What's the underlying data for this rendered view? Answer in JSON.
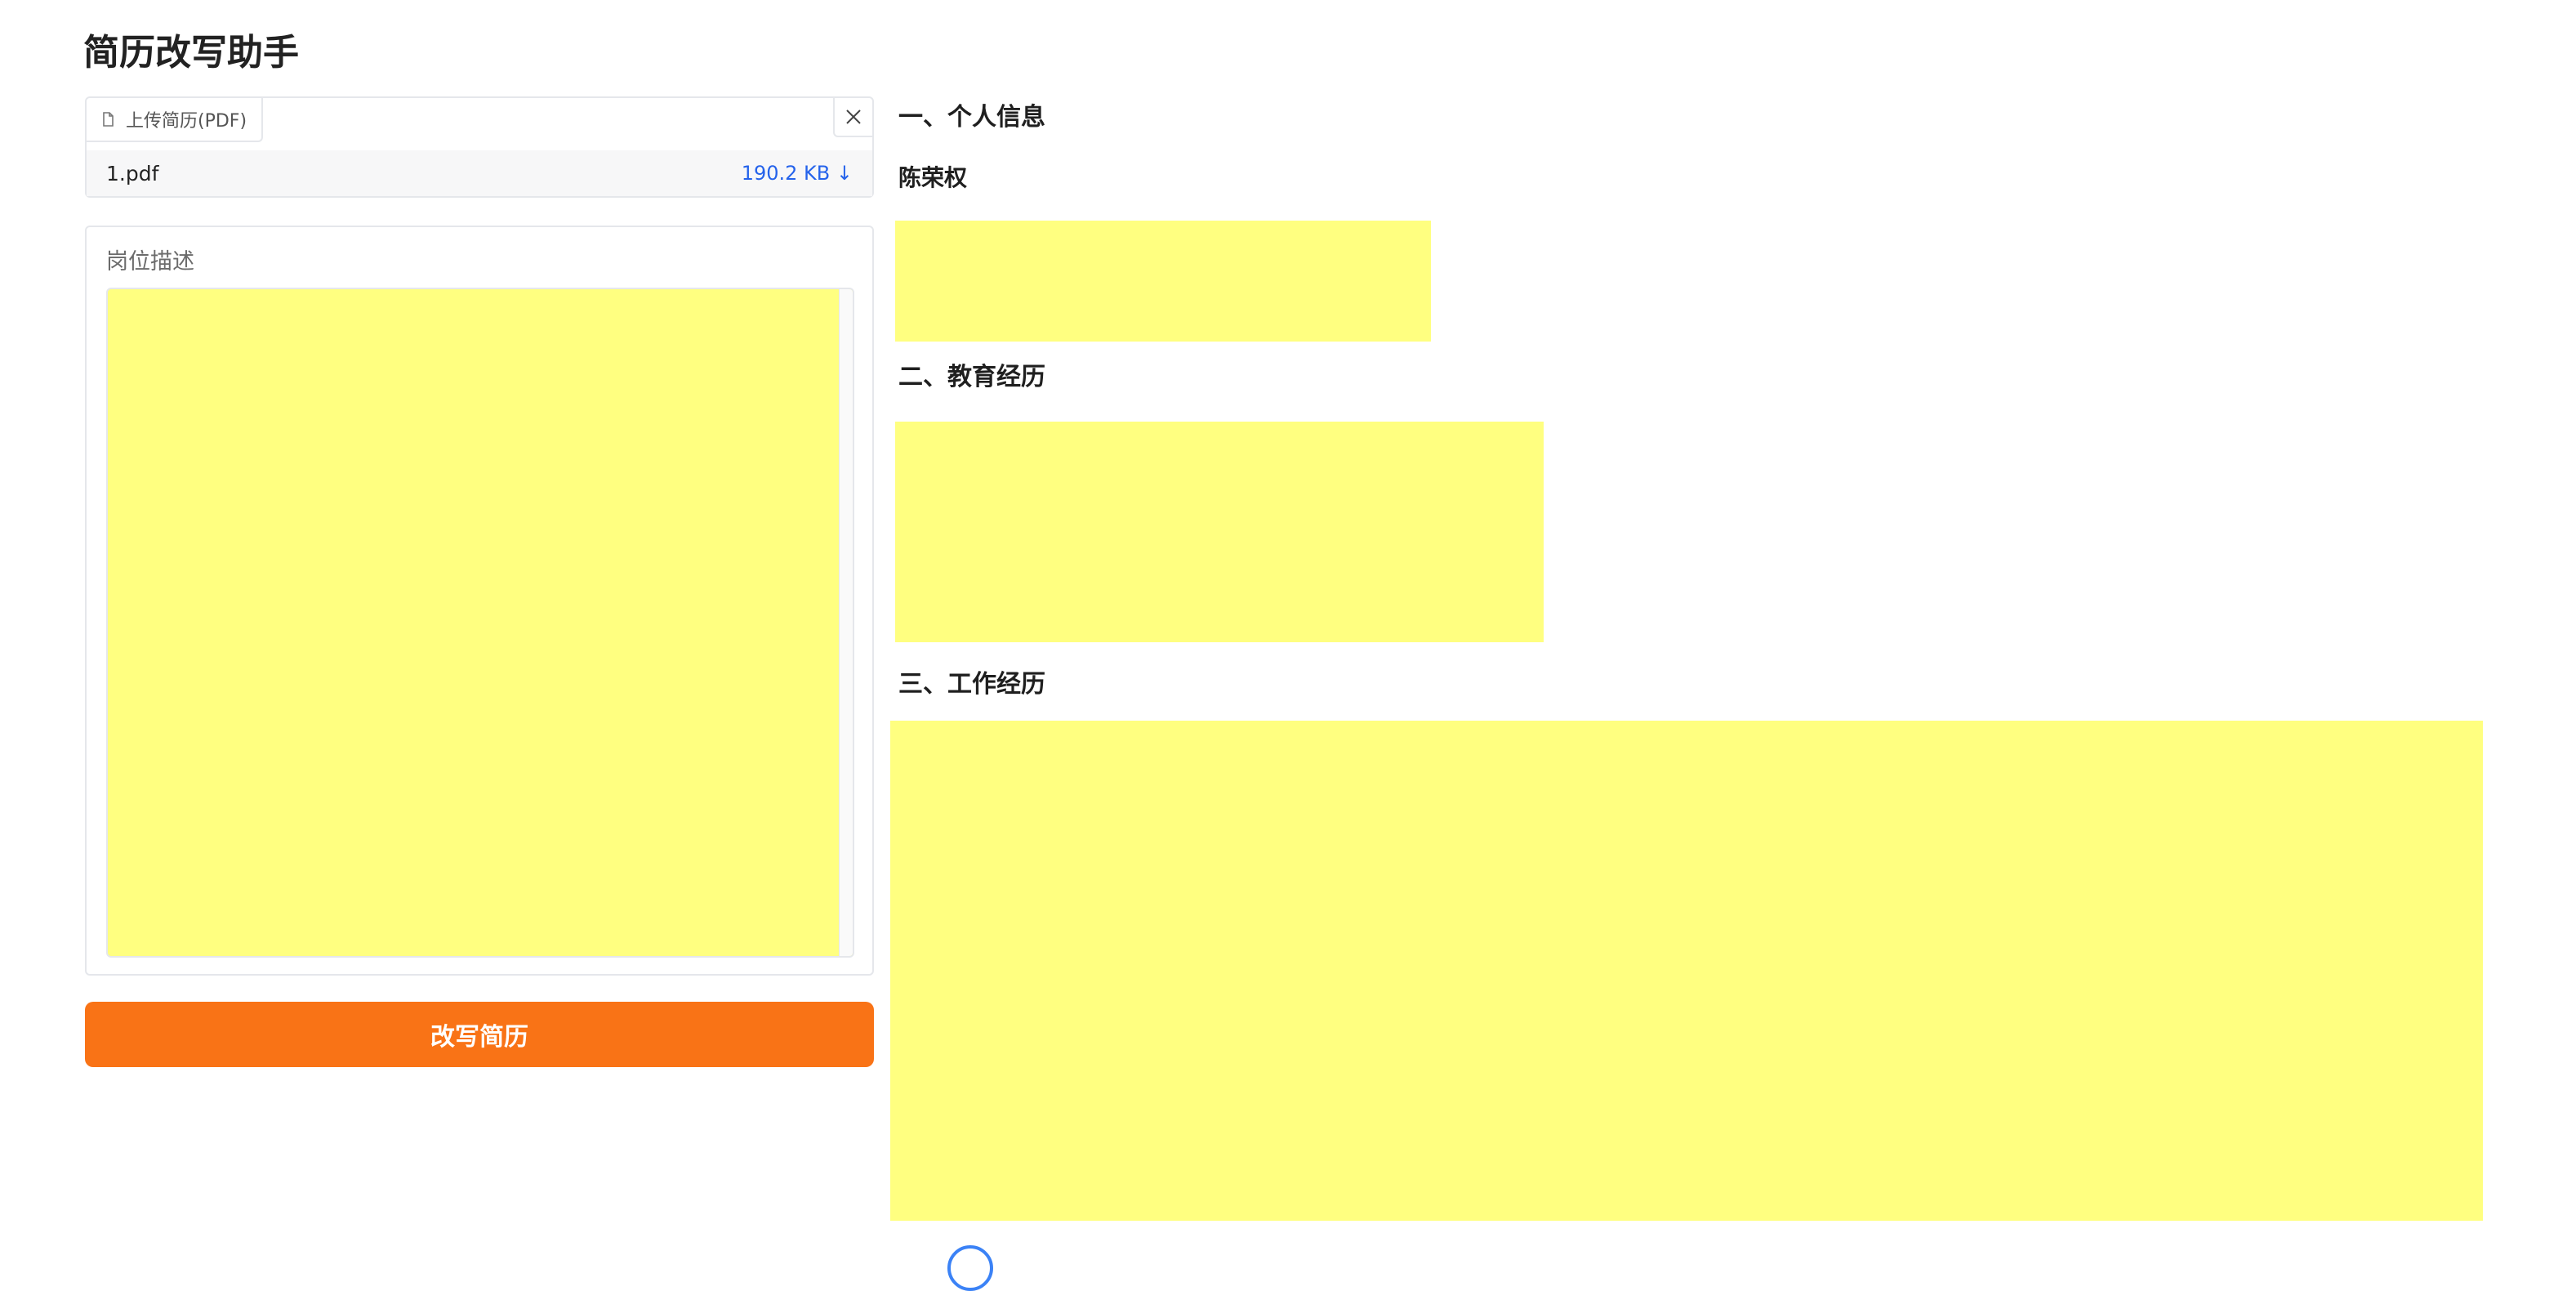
{
  "app": {
    "title": "简历改写助手"
  },
  "upload": {
    "tab_label": "上传简历(PDF)",
    "file_name": "1.pdf",
    "file_size": "190.2 KB ↓"
  },
  "job_description": {
    "label": "岗位描述"
  },
  "actions": {
    "rewrite_label": "改写简历"
  },
  "resume": {
    "section_personal": "一、个人信息",
    "name": "陈荣权",
    "section_education": "二、教育经历",
    "section_work": "三、工作经历"
  },
  "icons": {
    "file": "file-icon",
    "close": "close-icon",
    "loading": "loading-icon"
  },
  "colors": {
    "accent": "#f97316",
    "link": "#2563eb",
    "redaction": "#ffff80"
  }
}
